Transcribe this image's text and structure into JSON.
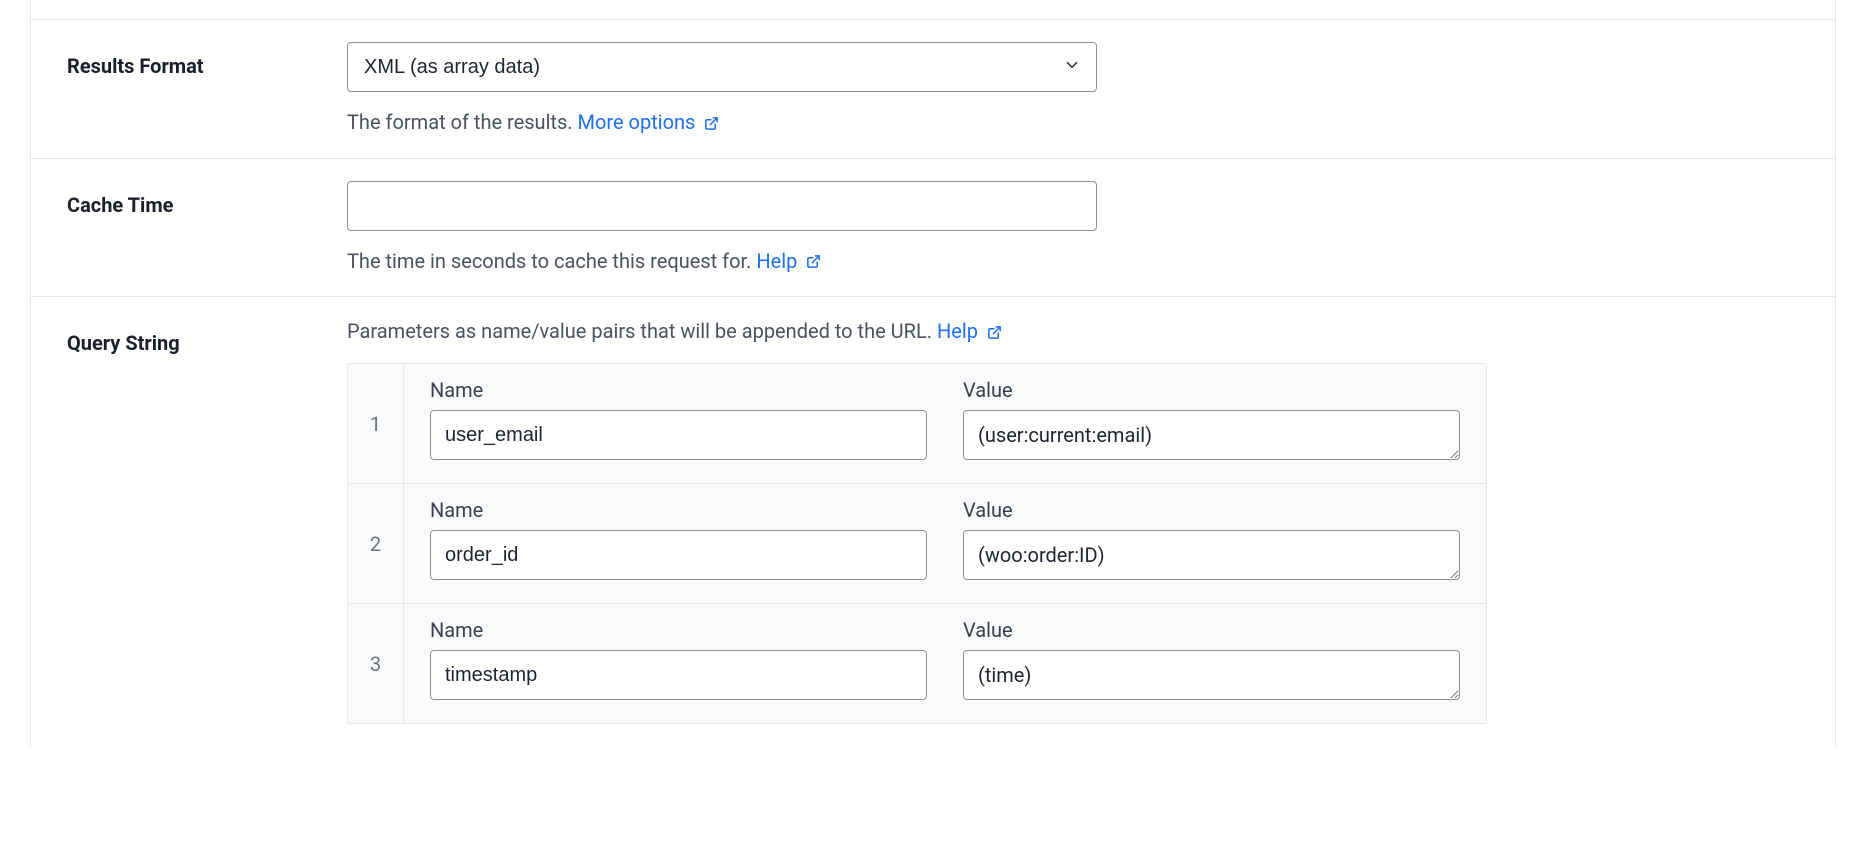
{
  "fields": {
    "resultsFormat": {
      "label": "Results Format",
      "value": "XML (as array data)",
      "helpText": "The format of the results. ",
      "helpLink": "More options"
    },
    "cacheTime": {
      "label": "Cache Time",
      "value": "",
      "helpText": "The time in seconds to cache this request for. ",
      "helpLink": "Help"
    },
    "queryString": {
      "label": "Query String",
      "helpText": "Parameters as name/value pairs that will be appended to the URL. ",
      "helpLink": "Help",
      "columnNameLabel": "Name",
      "columnValueLabel": "Value",
      "rows": [
        {
          "index": "1",
          "name": "user_email",
          "value": "(user:current:email)"
        },
        {
          "index": "2",
          "name": "order_id",
          "value": "(woo:order:ID)"
        },
        {
          "index": "3",
          "name": "timestamp",
          "value": "(time)"
        }
      ]
    }
  }
}
